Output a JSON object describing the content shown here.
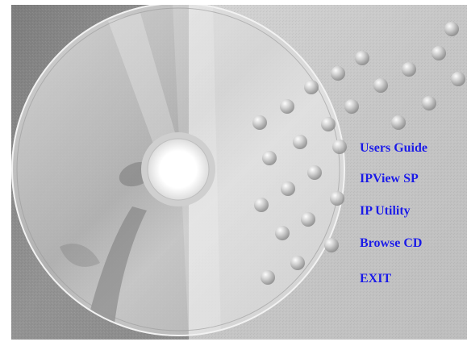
{
  "colors": {
    "menu_text": "#1a1ae6",
    "left_panel": "#8f8f8f",
    "right_panel": "#cbcbcb"
  },
  "background": {
    "disc_logo_icon": "cd-disc-i-logo-icon",
    "pattern_icon": "bead-dots-icon"
  },
  "menu": {
    "items": [
      {
        "label": "Users Guide"
      },
      {
        "label": "IPView SP"
      },
      {
        "label": "IP  Utility"
      },
      {
        "label": "Browse CD"
      },
      {
        "label": "EXIT"
      }
    ]
  }
}
